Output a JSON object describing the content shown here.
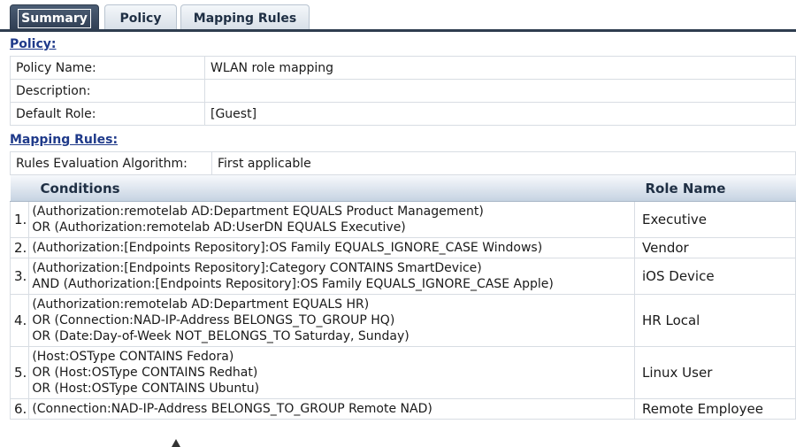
{
  "tabs": [
    {
      "label": "Summary",
      "active": true
    },
    {
      "label": "Policy",
      "active": false
    },
    {
      "label": "Mapping Rules",
      "active": false
    }
  ],
  "policy": {
    "section_title": "Policy:",
    "fields": [
      {
        "label": "Policy Name:",
        "value": "WLAN role mapping"
      },
      {
        "label": "Description:",
        "value": ""
      },
      {
        "label": "Default Role:",
        "value": "[Guest]"
      }
    ]
  },
  "mapping_rules": {
    "section_title": "Mapping Rules:",
    "algorithm_label": "Rules Evaluation Algorithm:",
    "algorithm_value": "First applicable",
    "columns": {
      "conditions": "Conditions",
      "role_name": "Role Name"
    },
    "rows": [
      {
        "num": "1.",
        "conditions": [
          "(Authorization:remotelab AD:Department EQUALS Product Management)",
          "OR (Authorization:remotelab AD:UserDN EQUALS Executive)"
        ],
        "role": "Executive"
      },
      {
        "num": "2.",
        "conditions": [
          "(Authorization:[Endpoints Repository]:OS Family EQUALS_IGNORE_CASE Windows)"
        ],
        "role": "Vendor"
      },
      {
        "num": "3.",
        "conditions": [
          "(Authorization:[Endpoints Repository]:Category CONTAINS SmartDevice)",
          "AND (Authorization:[Endpoints Repository]:OS Family EQUALS_IGNORE_CASE Apple)"
        ],
        "role": "iOS Device"
      },
      {
        "num": "4.",
        "conditions": [
          "(Authorization:remotelab AD:Department EQUALS HR)",
          "OR (Connection:NAD-IP-Address BELONGS_TO_GROUP HQ)",
          "OR (Date:Day-of-Week NOT_BELONGS_TO Saturday, Sunday)"
        ],
        "role": "HR Local"
      },
      {
        "num": "5.",
        "conditions": [
          "(Host:OSType CONTAINS Fedora)",
          "OR (Host:OSType CONTAINS Redhat)",
          "OR (Host:OSType CONTAINS Ubuntu)"
        ],
        "role": "Linux User"
      },
      {
        "num": "6.",
        "conditions": [
          "(Connection:NAD-IP-Address BELONGS_TO_GROUP Remote NAD)"
        ],
        "role": "Remote Employee"
      }
    ]
  },
  "colors": {
    "tab_active": "#2f3d4f",
    "section_title": "#1f3a8a",
    "header_gradient_end": "#c6d3e2"
  }
}
